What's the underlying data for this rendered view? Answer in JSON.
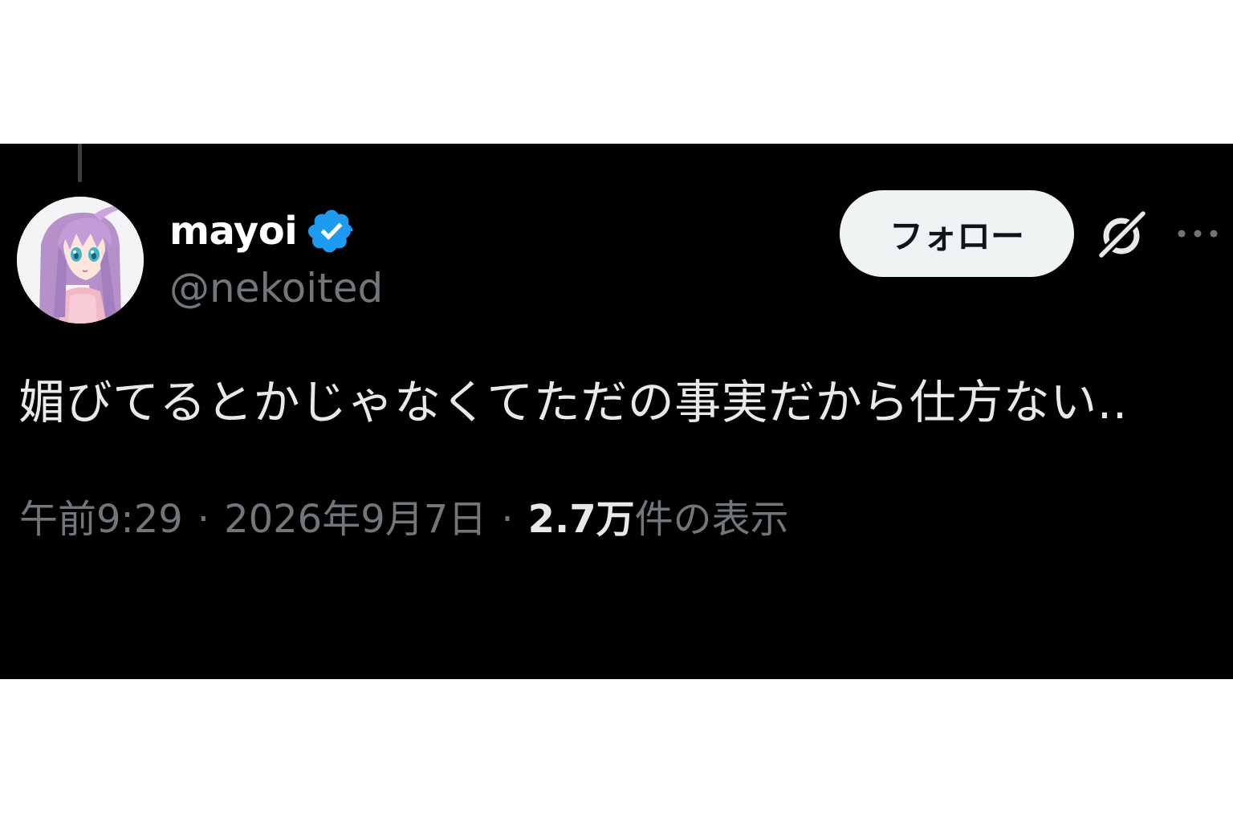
{
  "tweet": {
    "author": {
      "display_name": "mayoi",
      "handle": "@nekoited",
      "verified": true,
      "verified_icon": "verified-badge-icon",
      "avatar_icon": "anime-character-avatar"
    },
    "actions": {
      "follow_label": "フォロー",
      "grok_icon": "grok-icon",
      "more_icon": "more-options-icon"
    },
    "text": "媚びてるとかじゃなくてただの事実だから仕方ない..",
    "meta": {
      "time": "午前9:29",
      "separator": "·",
      "date": "2026年9月7日",
      "views_count": "2.7万",
      "views_label": "件の表示"
    }
  },
  "colors": {
    "background": "#000000",
    "page_margin": "#ffffff",
    "primary_text": "#e7e9ea",
    "secondary_text": "#71767b",
    "verified_blue": "#1d9bf0",
    "follow_button_bg": "#eff3f4"
  }
}
